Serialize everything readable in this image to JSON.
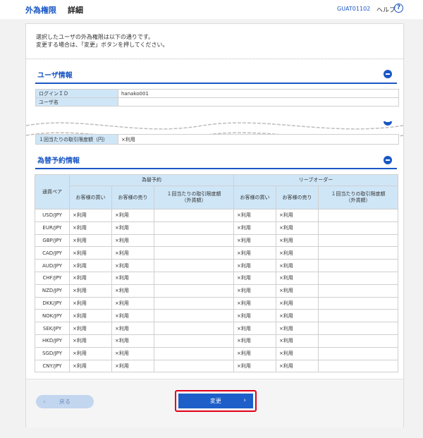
{
  "header": {
    "title": "外為権限",
    "subtitle": "詳細",
    "screen_code": "GUAT01102",
    "help_label": "ヘルプ",
    "help_icon": "?"
  },
  "intro": {
    "line1": "選択したユーザの外為権限は以下の通りです。",
    "line2": "変更する場合は、「変更」ボタンを押してください。"
  },
  "user_section": {
    "title": "ユーザ情報",
    "rows": [
      {
        "label": "ログインＩＤ",
        "value": "hanako001"
      },
      {
        "label": "ユーザ名",
        "value": ""
      }
    ],
    "limit_row": {
      "label": "１回当たりの取引限度額（円）",
      "value": "×利用"
    }
  },
  "fx_section": {
    "title": "為替予約情報",
    "col_pair": "通貨ペア",
    "group1": "為替予約",
    "group2": "リーブオーダー",
    "sub_buy": "お客様の買い",
    "sub_sell": "お客様の売り",
    "sub_limit_line1": "１回当たりの取引限度額",
    "sub_limit_line2": "（外貨額）",
    "rows": [
      {
        "pair": "USD/JPY",
        "buy1": "×利用",
        "sell1": "×利用",
        "buy2": "×利用",
        "sell2": "×利用"
      },
      {
        "pair": "EUR/JPY",
        "buy1": "×利用",
        "sell1": "×利用",
        "buy2": "×利用",
        "sell2": "×利用"
      },
      {
        "pair": "GBP/JPY",
        "buy1": "×利用",
        "sell1": "×利用",
        "buy2": "×利用",
        "sell2": "×利用"
      },
      {
        "pair": "CAD/JPY",
        "buy1": "×利用",
        "sell1": "×利用",
        "buy2": "×利用",
        "sell2": "×利用"
      },
      {
        "pair": "AUD/JPY",
        "buy1": "×利用",
        "sell1": "×利用",
        "buy2": "×利用",
        "sell2": "×利用"
      },
      {
        "pair": "CHF/JPY",
        "buy1": "×利用",
        "sell1": "×利用",
        "buy2": "×利用",
        "sell2": "×利用"
      },
      {
        "pair": "NZD/JPY",
        "buy1": "×利用",
        "sell1": "×利用",
        "buy2": "×利用",
        "sell2": "×利用"
      },
      {
        "pair": "DKK/JPY",
        "buy1": "×利用",
        "sell1": "×利用",
        "buy2": "×利用",
        "sell2": "×利用"
      },
      {
        "pair": "NOK/JPY",
        "buy1": "×利用",
        "sell1": "×利用",
        "buy2": "×利用",
        "sell2": "×利用"
      },
      {
        "pair": "SEK/JPY",
        "buy1": "×利用",
        "sell1": "×利用",
        "buy2": "×利用",
        "sell2": "×利用"
      },
      {
        "pair": "HKD/JPY",
        "buy1": "×利用",
        "sell1": "×利用",
        "buy2": "×利用",
        "sell2": "×利用"
      },
      {
        "pair": "SGD/JPY",
        "buy1": "×利用",
        "sell1": "×利用",
        "buy2": "×利用",
        "sell2": "×利用"
      },
      {
        "pair": "CNY/JPY",
        "buy1": "×利用",
        "sell1": "×利用",
        "buy2": "×利用",
        "sell2": "×利用"
      }
    ]
  },
  "buttons": {
    "back_label": "戻る",
    "change_label": "変更"
  },
  "colors": {
    "accent": "#1a57c5",
    "header_cell": "#cfe6f7",
    "highlight": "#e0001a"
  }
}
